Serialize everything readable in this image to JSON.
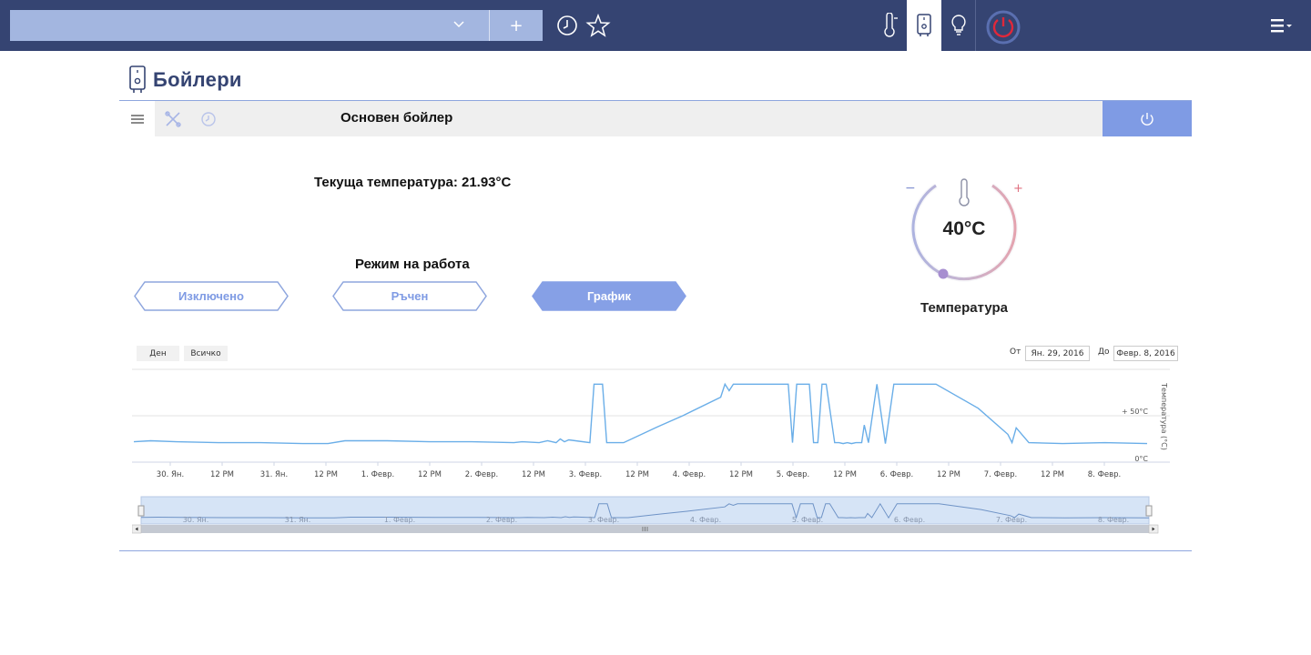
{
  "topbar": {
    "select_value": "",
    "add_label": "+",
    "icons": [
      "chevron-down-icon",
      "history-clock-icon",
      "star-icon",
      "thermometer-icon",
      "boiler-icon",
      "bulb-icon",
      "power-ring-icon",
      "menu-icon"
    ]
  },
  "page": {
    "title": "Бойлери"
  },
  "boiler": {
    "name": "Основен бойлер",
    "current_temperature_text": "Текуща температура: 21.93°C",
    "mode_title": "Режим на работа",
    "modes": [
      {
        "label": "Изключено",
        "active": false
      },
      {
        "label": "Ръчен",
        "active": false
      },
      {
        "label": "График",
        "active": true
      }
    ],
    "setpoint": {
      "value_text": "40°C",
      "label": "Температура",
      "minus": "−",
      "plus": "+",
      "level_fraction": 0.0
    }
  },
  "chart_controls": {
    "range_buttons": [
      "Ден",
      "Всичко"
    ],
    "from_label": "От",
    "from_value": "Ян. 29, 2016",
    "to_label": "До",
    "to_value": "Февр. 8, 2016"
  },
  "colors": {
    "topbar": "#354472",
    "accent": "#7f9be4",
    "line": "#6aaee8",
    "title": "#354472"
  },
  "chart_data": {
    "type": "line",
    "title": "",
    "ylabel": "Температура (°C)",
    "y_tick_labels": [
      "0°C",
      "+ 50°C"
    ],
    "ylim": [
      0,
      100
    ],
    "xlim": [
      0,
      10
    ],
    "x_tick_labels": [
      "30. Ян.",
      "12 PM",
      "31. Ян.",
      "12 PM",
      "1. Февр.",
      "12 PM",
      "2. Февр.",
      "12 PM",
      "3. Февр.",
      "12 PM",
      "4. Февр.",
      "12 PM",
      "5. Февр.",
      "12 PM",
      "6. Февр.",
      "12 PM",
      "7. Февр.",
      "12 PM",
      "8. Февр."
    ],
    "navigator_tick_labels": [
      "30. Ян.",
      "31. Ян.",
      "1. Февр.",
      "2. Февр.",
      "3. Февр.",
      "4. Февр.",
      "5. Февр.",
      "6. Февр.",
      "7. Февр.",
      "8. Февр."
    ],
    "x_start": "Ян. 29, 2016",
    "series": [
      {
        "x": [
          0,
          0.2,
          0.5,
          1.0,
          1.5,
          2.0,
          2.3,
          2.5,
          3.0,
          3.5,
          4.0,
          4.5,
          4.6,
          4.8,
          4.9,
          5.0,
          5.05,
          5.1,
          5.15,
          5.4,
          5.45,
          5.55,
          5.6,
          5.8,
          6.2,
          6.5,
          6.95,
          7.0,
          7.05,
          7.1,
          7.75,
          7.8,
          7.85,
          8.0,
          8.05,
          8.1,
          8.15,
          8.2,
          8.3,
          8.35,
          8.4,
          8.45,
          8.5,
          8.55,
          8.6,
          8.62,
          8.65,
          8.7,
          8.8,
          8.9,
          9.0,
          9.5,
          10.0,
          10.35,
          10.4,
          10.45,
          10.6,
          11.0,
          11.5,
          12.0
        ],
        "y": [
          22,
          23,
          22,
          21,
          21,
          20,
          20,
          23,
          23,
          22,
          22,
          21,
          22,
          21,
          23,
          21,
          25,
          22,
          24,
          21,
          84,
          84,
          21,
          21,
          38,
          50,
          70,
          84,
          77,
          84,
          84,
          21,
          84,
          84,
          21,
          21,
          84,
          84,
          21,
          21,
          20,
          21,
          20,
          21,
          21,
          21,
          40,
          21,
          84,
          20,
          84,
          84,
          58,
          30,
          21,
          37,
          21,
          20,
          21,
          20
        ]
      }
    ]
  }
}
